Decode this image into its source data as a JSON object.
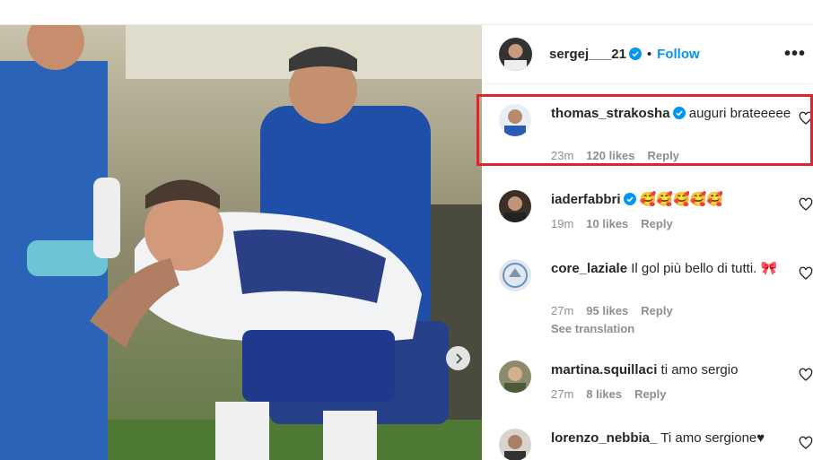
{
  "post": {
    "author": "sergej___21",
    "follow_label": "Follow",
    "separator": "•",
    "more_label": "•••"
  },
  "comments": [
    {
      "user": "thomas_strakosha",
      "verified": true,
      "text": "auguri brateeeee",
      "time": "23m",
      "likes": "120 likes",
      "reply": "Reply",
      "highlighted": true
    },
    {
      "user": "iaderfabbri",
      "verified": true,
      "text": "🥰🥰🥰🥰🥰",
      "time": "19m",
      "likes": "10 likes",
      "reply": "Reply"
    },
    {
      "user": "core_laziale",
      "verified": false,
      "text": "Il gol più bello di tutti. 🎀",
      "time": "27m",
      "likes": "95 likes",
      "reply": "Reply",
      "see_translation": "See translation"
    },
    {
      "user": "martina.squillaci",
      "verified": false,
      "text": "ti amo sergio",
      "time": "27m",
      "likes": "8 likes",
      "reply": "Reply"
    },
    {
      "user": "lorenzo_nebbia_",
      "verified": false,
      "text": "Ti amo sergione♥",
      "time": "",
      "likes": "",
      "reply": ""
    }
  ],
  "colors": {
    "accent": "#0095f6",
    "highlight_box": "#e0242c",
    "muted_text": "#8e8e8e",
    "verified_badge": "#0095f6"
  },
  "icons": [
    "verified-badge-icon",
    "heart-icon",
    "more-icon",
    "next-arrow-icon"
  ]
}
